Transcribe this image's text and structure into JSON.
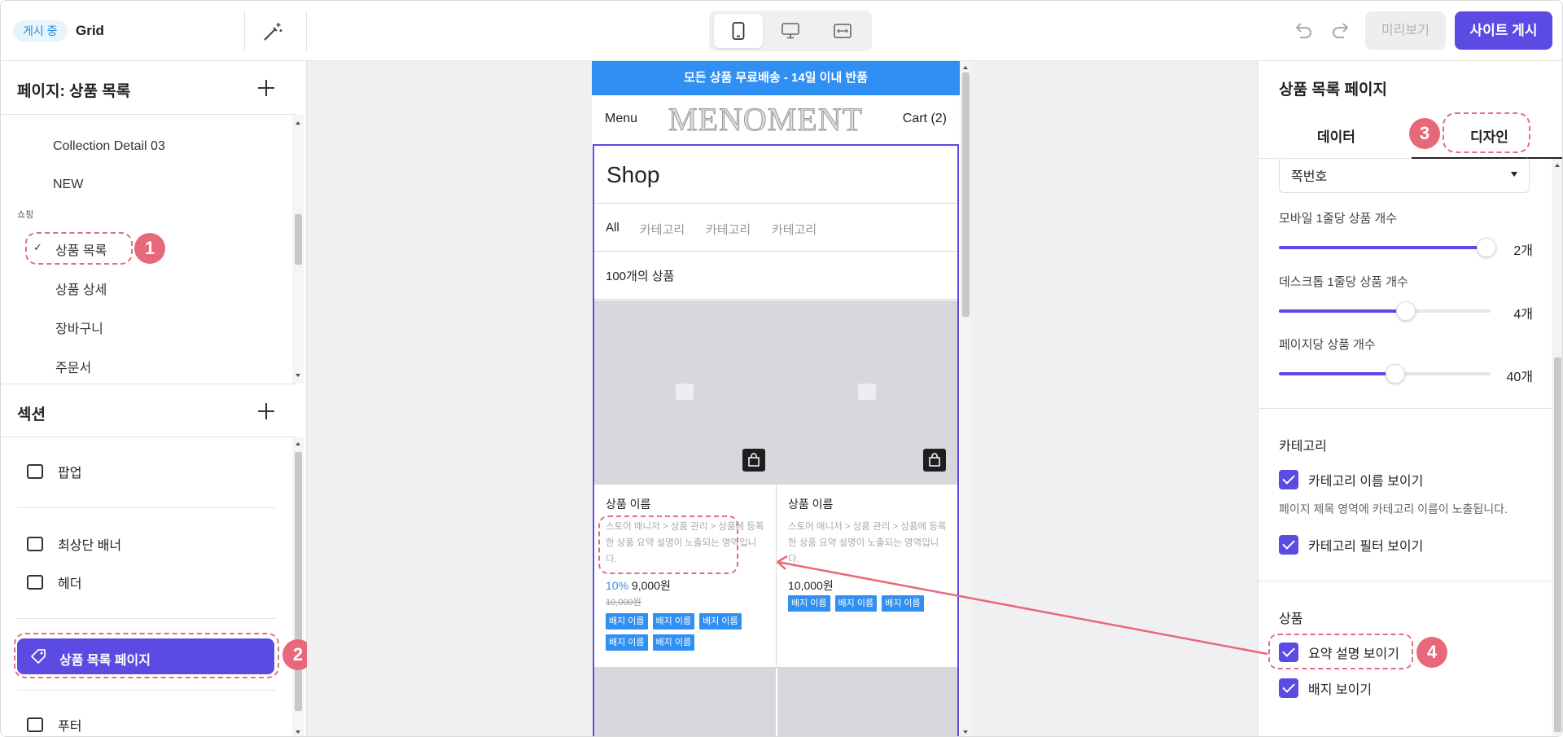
{
  "topbar": {
    "status": "게시 중",
    "site_name": "Grid",
    "preview_label": "미리보기",
    "publish_label": "사이트 게시",
    "devices": [
      "mobile-icon",
      "desktop-icon",
      "responsive-icon"
    ]
  },
  "pages_panel": {
    "title": "페이지: 상품 목록",
    "items_top": [
      "Collection Detail 03",
      "NEW"
    ],
    "group_label": "쇼핑",
    "shopping_items": [
      "상품 목록",
      "상품 상세",
      "장바구니",
      "주문서"
    ],
    "selected_check": "✓"
  },
  "sections_panel": {
    "title": "섹션",
    "items": [
      "팝업",
      "최상단 배너",
      "헤더",
      "상품 목록 페이지",
      "푸터"
    ]
  },
  "preview": {
    "notice": "모든 상품 무료배송 - 14일 이내 반품",
    "menu": "Menu",
    "logo": "MENOMENT",
    "cart": "Cart (2)",
    "shop_title": "Shop",
    "tabs": [
      "All",
      "카테고리",
      "카테고리",
      "카테고리"
    ],
    "count": "100개의 상품",
    "products": [
      {
        "name": "상품 이름",
        "desc": "스토어 매니저 > 상품 관리 > 상품에 등록한 상품 요약 설명이 노출되는 영역입니다.",
        "rate": "10%",
        "price": "9,000원",
        "orig": "10,000원",
        "badges": [
          "배지 이름",
          "배지 이름",
          "배지 이름",
          "배지 이름",
          "배지 이름"
        ]
      },
      {
        "name": "상품 이름",
        "desc": "스토어 매니저 > 상품 관리 > 상품에 등록한 상품 요약 설명이 노출되는 영역입니다.",
        "rate": "",
        "price": "10,000원",
        "orig": "",
        "badges": [
          "배지 이름",
          "배지 이름",
          "배지 이름"
        ]
      }
    ]
  },
  "settings_panel": {
    "title": "상품 목록 페이지",
    "tabs": [
      "데이터",
      "디자인"
    ],
    "pagination_select": "쪽번호",
    "sliders": [
      {
        "label": "모바일 1줄당 상품 개수",
        "value_text": "2개",
        "fraction": 0.98
      },
      {
        "label": "데스크톱 1줄당 상품 개수",
        "value_text": "4개",
        "fraction": 0.6
      },
      {
        "label": "페이지당 상품 개수",
        "value_text": "40개",
        "fraction": 0.55
      }
    ],
    "category_section": "카테고리",
    "category_options": [
      "카테고리 이름 보이기",
      "카테고리 필터 보이기"
    ],
    "category_help": "페이지 제목 영역에 카테고리 이름이 노출됩니다.",
    "product_section": "상품",
    "product_options": [
      "요약 설명 보이기",
      "배지 보이기"
    ]
  },
  "annotations": [
    "1",
    "2",
    "3",
    "4"
  ],
  "colors": {
    "accent": "#5b4be2",
    "notice": "#2f8ff2",
    "annotation": "#e7687a"
  }
}
